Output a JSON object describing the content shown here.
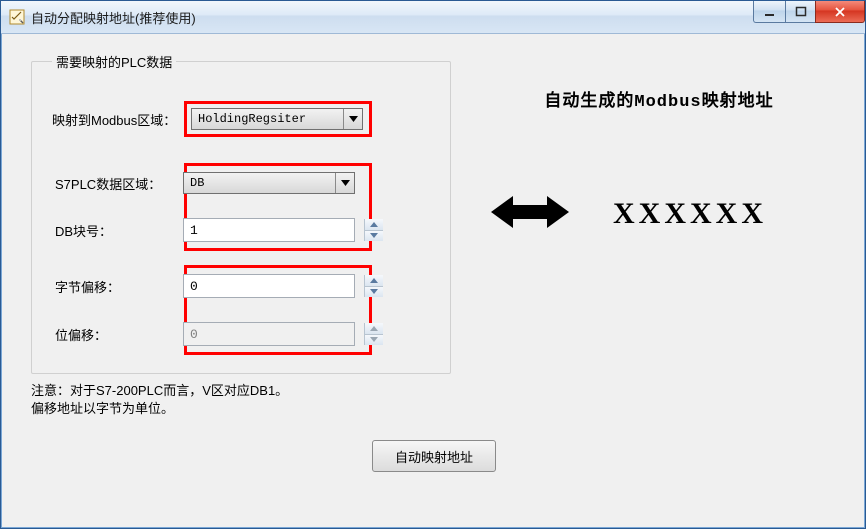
{
  "window": {
    "title": "自动分配映射地址(推荐使用)"
  },
  "fieldset": {
    "legend": "需要映射的PLC数据"
  },
  "labels": {
    "modbus_area": "映射到Modbus区域：",
    "s7_area": "S7PLC数据区域：",
    "db_number": "DB块号：",
    "byte_offset": "字节偏移：",
    "bit_offset": "位偏移："
  },
  "values": {
    "modbus_area_selected": "HoldingRegsiter",
    "s7_area_selected": "DB",
    "db_number": "1",
    "byte_offset": "0",
    "bit_offset": "0"
  },
  "note": {
    "line1": "注意：对于S7-200PLC而言，V区对应DB1。",
    "line2": "偏移地址以字节为单位。"
  },
  "buttons": {
    "auto_map": "自动映射地址"
  },
  "right": {
    "title": "自动生成的Modbus映射地址",
    "result": "XXXXXX"
  }
}
